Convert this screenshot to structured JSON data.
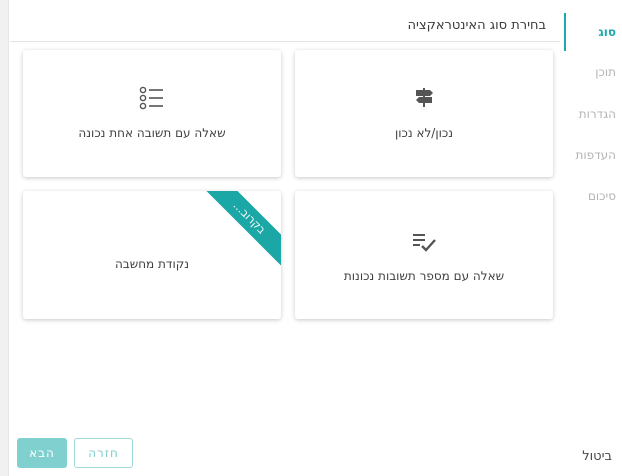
{
  "header": {
    "title": "בחירת סוג האינטראקציה"
  },
  "nav": {
    "items": [
      {
        "label": "סוג",
        "active": true
      },
      {
        "label": "תוכן",
        "active": false
      },
      {
        "label": "הגדרות",
        "active": false
      },
      {
        "label": "העדפות",
        "active": false
      },
      {
        "label": "סיכום",
        "active": false
      }
    ],
    "cancel_label": "ביטול"
  },
  "cards": {
    "true_false": {
      "label": "נכון/לא נכון",
      "icon": "signpost-icon"
    },
    "single_choice": {
      "label": "שאלה עם תשובה אחת נכונה",
      "icon": "list-icon"
    },
    "multi_choice": {
      "label": "שאלה עם מספר תשובות נכונות",
      "icon": "checklist-icon"
    },
    "thinking_point": {
      "label": "נקודת מחשבה",
      "ribbon": "בקרוב..."
    }
  },
  "footer": {
    "back_label": "חזרה",
    "next_label": "הבא"
  },
  "colors": {
    "accent": "#1da9a9",
    "ribbon": "#1ba7a5",
    "button_disabled": "#7fd0cf"
  }
}
